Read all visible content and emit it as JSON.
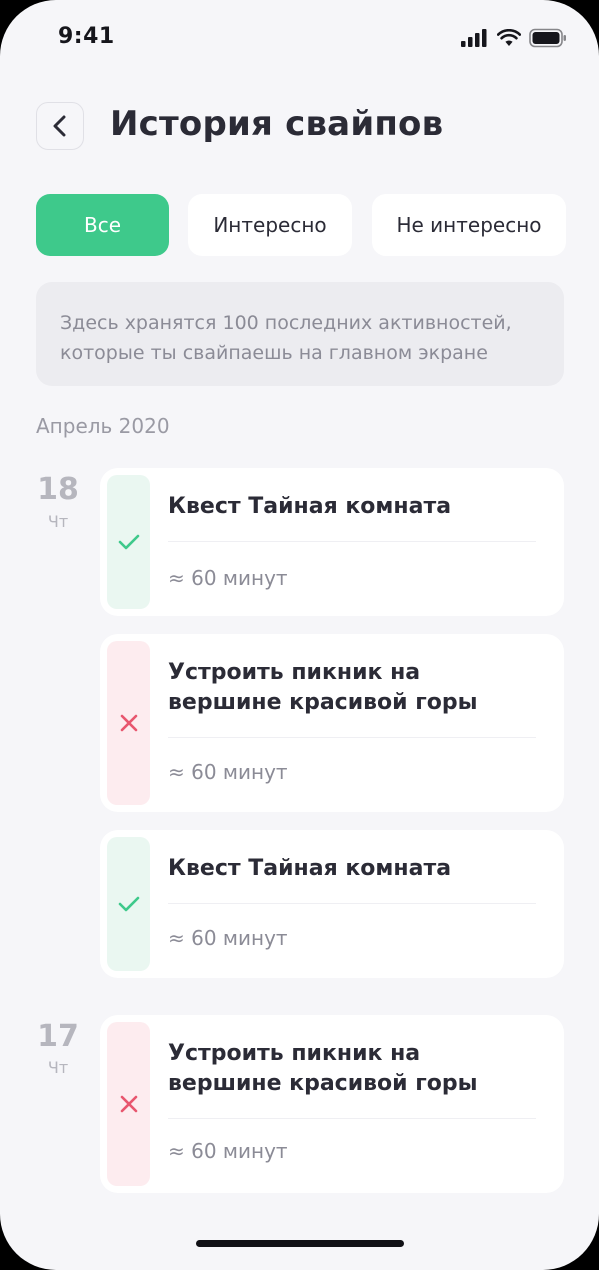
{
  "status_bar": {
    "time": "9:41"
  },
  "header": {
    "title": "История свайпов"
  },
  "tabs": [
    {
      "label": "Все",
      "active": true
    },
    {
      "label": "Интересно",
      "active": false
    },
    {
      "label": "Не интересно",
      "active": false
    }
  ],
  "info_text": "Здесь хранятся 100 последних активностей, которые ты свайпаешь на главном экране",
  "month_label": "Апрель 2020",
  "days": [
    {
      "day": "18",
      "weekday": "Чт"
    },
    {
      "day": "17",
      "weekday": "Чт"
    }
  ],
  "items": [
    {
      "title": "Квест Тайная комната",
      "duration": "≈ 60 минут",
      "status": "interested",
      "icon": "check-icon"
    },
    {
      "title": "Устроить пикник на вершине красивой горы",
      "duration": "≈ 60 минут",
      "status": "not-interested",
      "icon": "cross-icon"
    },
    {
      "title": "Квест Тайная комната",
      "duration": "≈ 60 минут",
      "status": "interested",
      "icon": "check-icon"
    },
    {
      "title": "Устроить пикник на вершине красивой горы",
      "duration": "≈ 60 минут",
      "status": "not-interested",
      "icon": "cross-icon"
    }
  ],
  "colors": {
    "accent_green": "#3ec98b",
    "cross_red": "#e8566e",
    "background": "#f6f6f9"
  }
}
